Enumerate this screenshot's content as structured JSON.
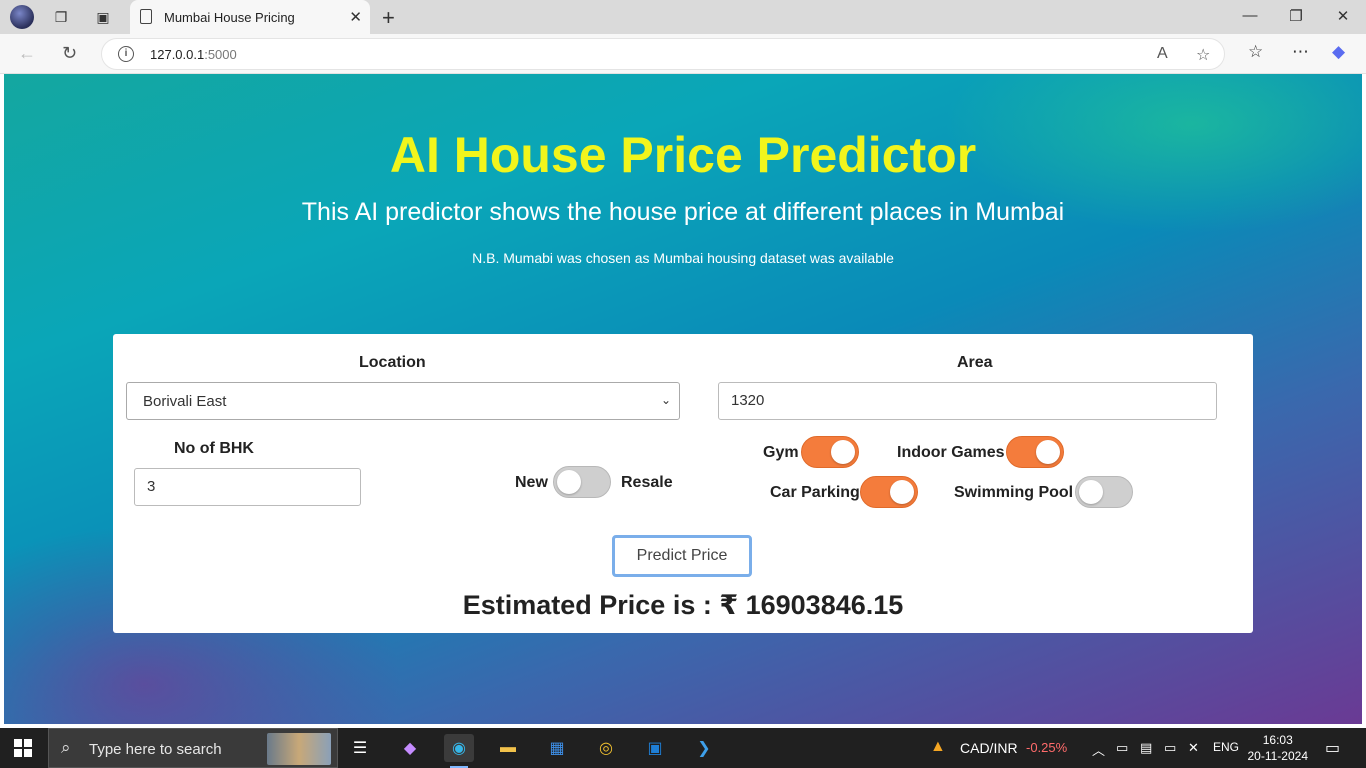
{
  "browser": {
    "tab_title": "Mumbai House Pricing",
    "url_host": "127.0.0.1",
    "url_port": ":5000"
  },
  "page": {
    "title": "AI House Price Predictor",
    "subtitle": "This AI predictor shows the house price at different places in Mumbai",
    "note": "N.B. Mumabi was chosen as Mumbai housing dataset was available"
  },
  "form": {
    "location_label": "Location",
    "location_value": "Borivali East",
    "area_label": "Area",
    "area_value": "1320",
    "bhk_label": "No of BHK",
    "bhk_value": "3",
    "new_label": "New",
    "resale_label": "Resale",
    "resale_on": false,
    "gym_label": "Gym",
    "gym_on": true,
    "indoor_label": "Indoor Games",
    "indoor_on": true,
    "parking_label": "Car Parking",
    "parking_on": true,
    "pool_label": "Swimming Pool",
    "pool_on": false,
    "button_label": "Predict Price",
    "result": "Estimated Price is : ₹ 16903846.15"
  },
  "taskbar": {
    "search_placeholder": "Type here to search",
    "ticker": "CAD/INR",
    "ticker_change": "-0.25%",
    "lang": "ENG",
    "time": "16:03",
    "date": "20-11-2024"
  },
  "colors": {
    "accent_toggle": "#f47c3c",
    "title_yellow": "#f1f51c",
    "ticker_red": "#ff6b6b"
  }
}
